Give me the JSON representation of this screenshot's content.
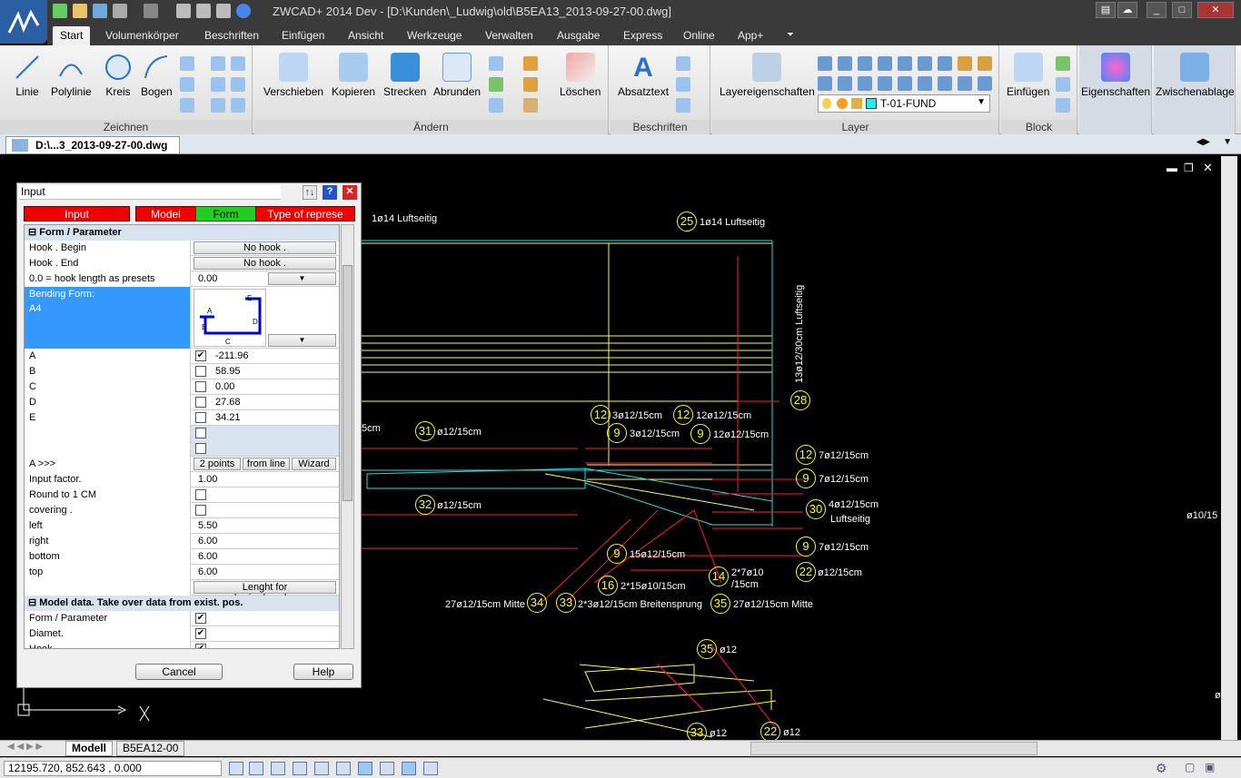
{
  "window": {
    "title": "ZWCAD+ 2014 Dev - [D:\\Kunden\\_Ludwig\\old\\B5EA13_2013-09-27-00.dwg]"
  },
  "menu": {
    "tabs": [
      "Start",
      "Volumenkörper",
      "Beschriften",
      "Einfügen",
      "Ansicht",
      "Werkzeuge",
      "Verwalten",
      "Ausgabe",
      "Express",
      "Online",
      "App+"
    ]
  },
  "ribbon": {
    "zeichnen": {
      "label": "Zeichnen",
      "buttons": [
        "Linie",
        "Polylinie",
        "Kreis",
        "Bogen"
      ]
    },
    "aendern": {
      "label": "Ändern",
      "buttons": [
        "Verschieben",
        "Kopieren",
        "Strecken",
        "Abrunden",
        "Löschen"
      ]
    },
    "beschriften": {
      "label": "Beschriften",
      "buttons": [
        "Absatztext"
      ]
    },
    "layer": {
      "label": "Layer",
      "button": "Layereigenschaften",
      "current": "T-01-FUND"
    },
    "block": {
      "label": "Block",
      "button": "Einfügen"
    },
    "eigenschaften": "Eigenschaften",
    "zwischenablage": "Zwischenablage"
  },
  "document_tab": "D:\\...3_2013-09-27-00.dwg",
  "dialog": {
    "title": "Input",
    "tabs": [
      "Input",
      "Model",
      "Form",
      "Type of represe"
    ],
    "section_form": "Form / Parameter",
    "rows": {
      "hook_begin": {
        "k": "Hook . Begin",
        "v": "No hook  ."
      },
      "hook_end": {
        "k": "Hook . End",
        "v": "No hook  ."
      },
      "hook_len": {
        "k": "0.0   = hook length as presets",
        "v": "0.00"
      },
      "bending": {
        "k": "Bending Form:",
        "k2": "A4"
      },
      "a": {
        "k": "A",
        "v": "-211.96"
      },
      "b": {
        "k": "B",
        "v": "58.95"
      },
      "c": {
        "k": "C",
        "v": "0.00"
      },
      "d": {
        "k": "D",
        "v": "27.68"
      },
      "e": {
        "k": "E",
        "v": "34.21"
      },
      "a_more": {
        "k": "A  >>>",
        "b1": "2 points",
        "b2": "from line",
        "b3": "Wizard"
      },
      "input_factor": {
        "k": "Input factor.",
        "v": "1.00"
      },
      "round": {
        "k": "Round to 1 CM"
      },
      "covering": {
        "k": "covering     ."
      },
      "left": {
        "k": "left",
        "v": "5.50"
      },
      "right": {
        "k": "right",
        "v": "6.00"
      },
      "bottom": {
        "k": "bottom",
        "v": "6.00"
      },
      "top": {
        "k": "top",
        "v": "6.00"
      },
      "anchoring": {
        "v": "Lenght for anchoring/overlapp..."
      }
    },
    "section_model": "Model data.  Take over data from exist. pos.",
    "model_rows": [
      "Form / Parameter",
      "Diamet.",
      "Hook"
    ],
    "shape_labels": [
      "A",
      "B",
      "C",
      "D",
      "E"
    ],
    "cancel": "Cancel",
    "help": "Help"
  },
  "cad": {
    "labels": [
      "1ø14 Luftseitig",
      "1ø14 Luftseitig",
      "13ø12/30cm  Luftseitig",
      "5cm",
      "ø12/15cm",
      "ø12/15cm",
      "3ø12/15cm",
      "12ø12/15cm",
      "3ø12/15cm",
      "12ø12/15cm",
      "7ø12/15cm",
      "7ø12/15cm",
      "4ø12/15cm",
      "Luftseitig",
      "7ø12/15cm",
      "ø12/15cm",
      "15ø12/15cm",
      "2*15ø10/15cm",
      "2*7ø10",
      "/15cm",
      "27ø12/15cm Mitte",
      "2*3ø12/15cm Breitensprung",
      "27ø12/15cm Mitte",
      "ø12",
      "ø12",
      "ø12",
      "ø10/15",
      "ø"
    ],
    "bubbles": [
      "25",
      "28",
      "31",
      "32",
      "12",
      "9",
      "12",
      "9",
      "12",
      "9",
      "30",
      "9",
      "22",
      "9",
      "16",
      "14",
      "34",
      "33",
      "35",
      "35",
      "33",
      "22"
    ]
  },
  "layout_tabs": [
    "Modell",
    "B5EA12-00"
  ],
  "coordinates": "12195.720, 852.643 , 0.000"
}
